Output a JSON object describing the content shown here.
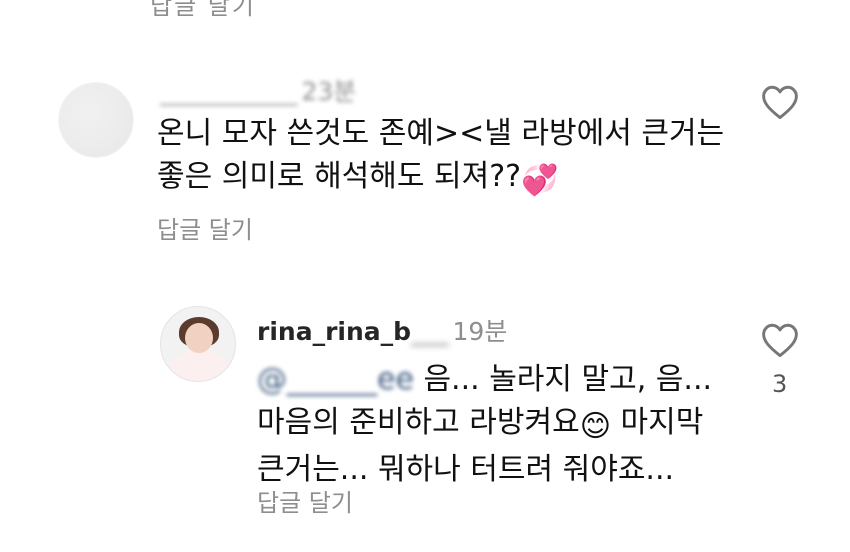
{
  "top_cut": {
    "reply_label": "답글 달기"
  },
  "comments": [
    {
      "username": "___________",
      "time": "23분",
      "text_line1": "온니 모자 쓴것도 존예><낼 라방에서 큰거는",
      "text_line2": "좋은 의미로 해석해도 되져??",
      "emoji": "💞",
      "reply_label": "답글 달기",
      "like_icon": "heart-outline-icon"
    },
    {
      "username_visible": "rina_rina_b",
      "username_hidden": "___",
      "time": "19분",
      "mention": "@______ee",
      "text_line1": " 음... 놀라지 말고, 음...",
      "text_line2a": "마음의 준비하고 라방켜요",
      "emoji": "😊",
      "text_line2b": " 마지막",
      "text_line3": "큰거는... 뭐하나 터트려 줘야죠...",
      "reply_label": "답글 달기",
      "like_icon": "heart-outline-icon",
      "like_count": "3"
    }
  ]
}
